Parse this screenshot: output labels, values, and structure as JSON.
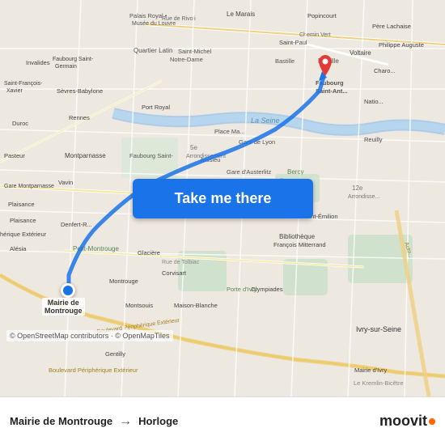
{
  "map": {
    "background_color": "#e8e0d8",
    "copyright": "© OpenStreetMap contributors · © OpenMapTiles"
  },
  "button": {
    "label": "Take me there"
  },
  "bottom_bar": {
    "from": "Mairie de Montrouge",
    "arrow": "→",
    "to": "Horloge",
    "logo": "moovit"
  },
  "origin": {
    "label": "Mairie de\nMontrouge"
  }
}
